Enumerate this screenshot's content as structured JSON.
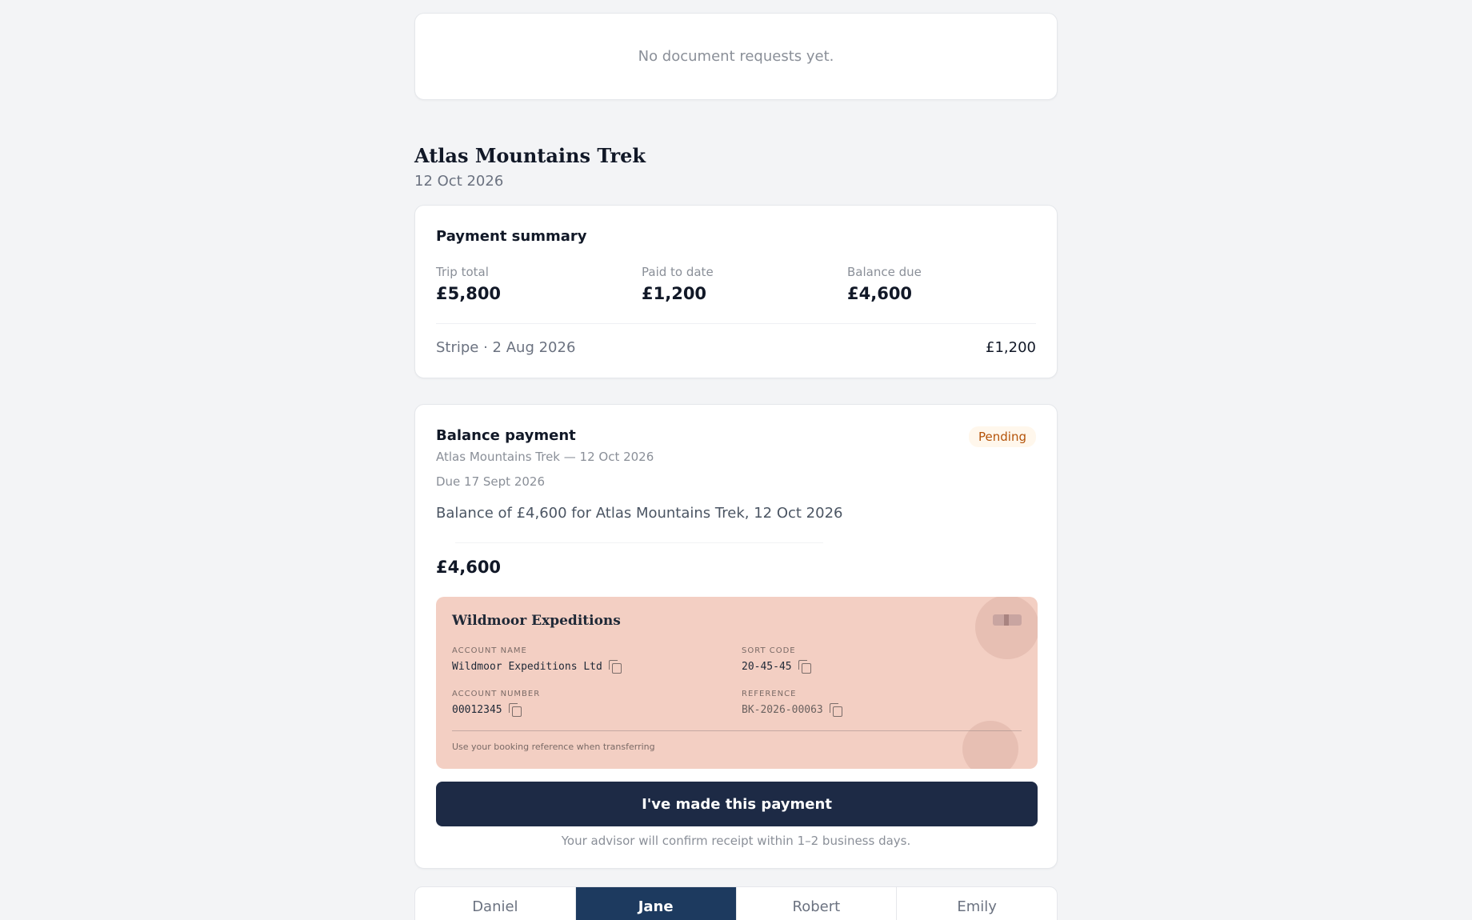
{
  "documents": {
    "empty_text": "No document requests yet."
  },
  "trip": {
    "title": "Atlas Mountains Trek",
    "date": "12 Oct 2026"
  },
  "summary": {
    "heading": "Payment summary",
    "stats": [
      {
        "label": "Trip total",
        "value": "£5,800"
      },
      {
        "label": "Paid to date",
        "value": "£1,200"
      },
      {
        "label": "Balance due",
        "value": "£4,600"
      }
    ],
    "transaction": {
      "label": "Stripe · 2 Aug 2026",
      "amount": "£1,200"
    }
  },
  "balance_payment": {
    "heading": "Balance payment",
    "status": "Pending",
    "subtitle": "Atlas Mountains Trek — 12 Oct 2026",
    "due": "Due 17 Sept 2026",
    "description": "Balance of £4,600 for Atlas Mountains Trek, 12 Oct 2026",
    "amount": "£4,600",
    "bank": {
      "company": "Wildmoor Expeditions",
      "account_name_label": "ACCOUNT NAME",
      "account_name": "Wildmoor Expeditions Ltd",
      "sort_code_label": "SORT CODE",
      "sort_code": "20-45-45",
      "account_number_label": "ACCOUNT NUMBER",
      "account_number": "00012345",
      "reference_label": "REFERENCE",
      "reference": "BK-2026-00063",
      "note": "Use your booking reference when transferring"
    },
    "cta_label": "I've made this payment",
    "cta_note": "Your advisor will confirm receipt within 1–2 business days."
  },
  "travellers": {
    "tabs": [
      "Daniel",
      "Jane",
      "Robert",
      "Emily"
    ],
    "active": "Jane"
  },
  "colors": {
    "navy": "#1d2a45",
    "tab_active": "#1d3a5f",
    "bank_panel": "#f3cfc3",
    "pending": "#b45309"
  }
}
